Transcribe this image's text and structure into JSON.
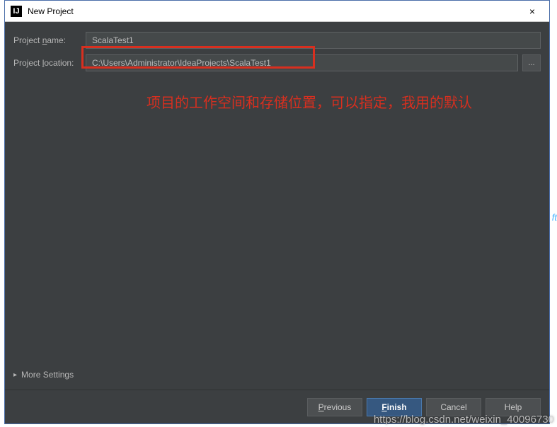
{
  "titlebar": {
    "icon_text": "IJ",
    "title": "New Project",
    "close": "×"
  },
  "form": {
    "name_label_prefix": "Project ",
    "name_label_ul": "n",
    "name_label_suffix": "ame:",
    "name_value": "ScalaTest1",
    "location_label_prefix": "Project ",
    "location_label_ul": "l",
    "location_label_suffix": "ocation:",
    "location_value": "C:\\Users\\Administrator\\IdeaProjects\\ScalaTest1",
    "browse_dots": "..."
  },
  "annotation_text": "项目的工作空间和存储位置，可以指定，我用的默认",
  "more_settings": {
    "arrow": "▸",
    "label": "More Settings"
  },
  "buttons": {
    "previous_ul": "P",
    "previous_rest": "revious",
    "finish_ul": "F",
    "finish_rest": "inish",
    "cancel": "Cancel",
    "help": "Help"
  },
  "watermark": "https://blog.csdn.net/weixin_40096730",
  "edge_hint": "ft"
}
